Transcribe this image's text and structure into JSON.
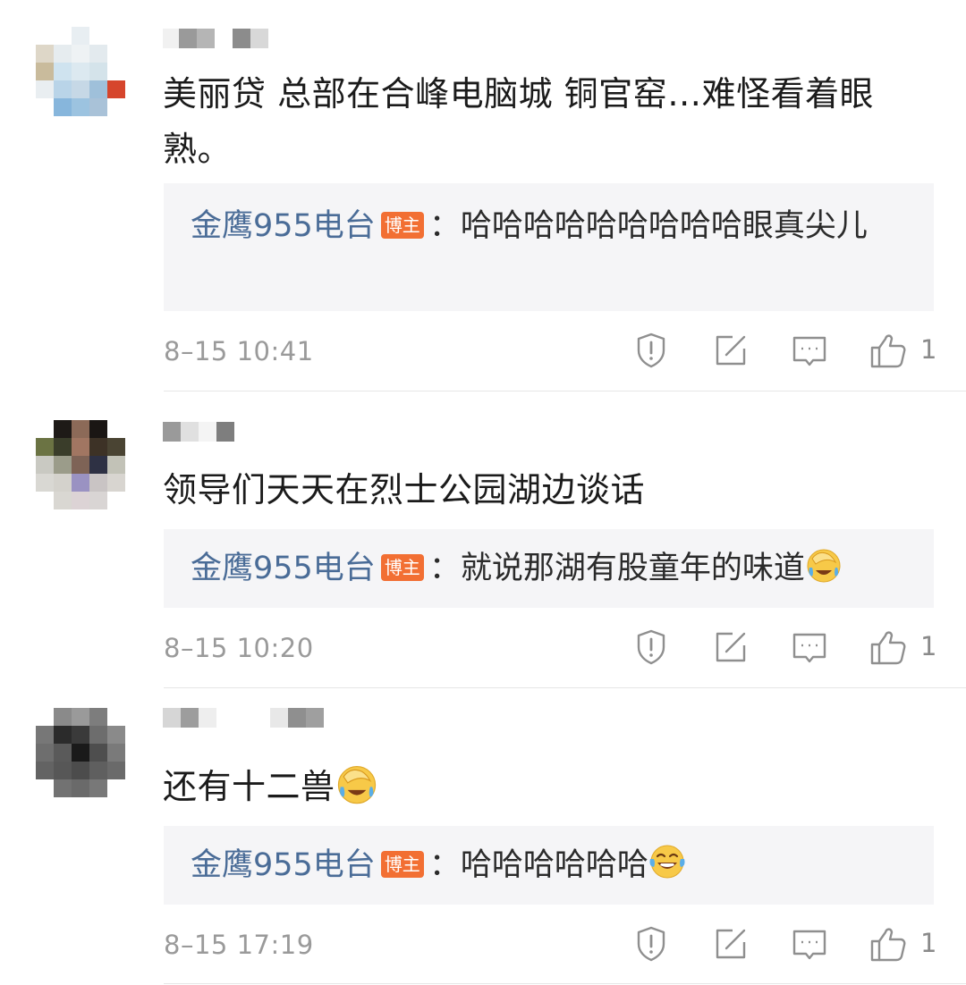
{
  "comments": [
    {
      "content": "美丽贷 总部在合峰电脑城 铜官窑…难怪看着眼熟。",
      "reply": {
        "author": "金鹰955电台",
        "badge": "博主",
        "separator": "：",
        "text": "哈哈哈哈哈哈哈哈哈眼真尖儿"
      },
      "time": "8–15 10:41",
      "likes": "1"
    },
    {
      "content": "领导们天天在烈士公园湖边谈话",
      "reply": {
        "author": "金鹰955电台",
        "badge": "博主",
        "separator": "：",
        "text": "就说那湖有股童年的味道",
        "emoji": "crying-laughing-emoji"
      },
      "time": "8–15 10:20",
      "likes": "1"
    },
    {
      "content": "还有十二兽",
      "content_emoji": "crying-laughing-emoji",
      "reply": {
        "author": "金鹰955电台",
        "badge": "博主",
        "separator": "：",
        "text": "哈哈哈哈哈哈",
        "emoji": "tears-of-joy-emoji"
      },
      "time": "8–15 17:19",
      "likes": "1"
    }
  ],
  "icons": {
    "report": "report-icon",
    "share": "share-icon",
    "reply": "comment-icon",
    "like": "like-icon"
  },
  "colors": {
    "author_link": "#4a6c97",
    "badge": "#f26f33",
    "reply_bg": "#f5f5f7",
    "meta_text": "#9a9a9a",
    "icon": "#8f8f8f"
  }
}
